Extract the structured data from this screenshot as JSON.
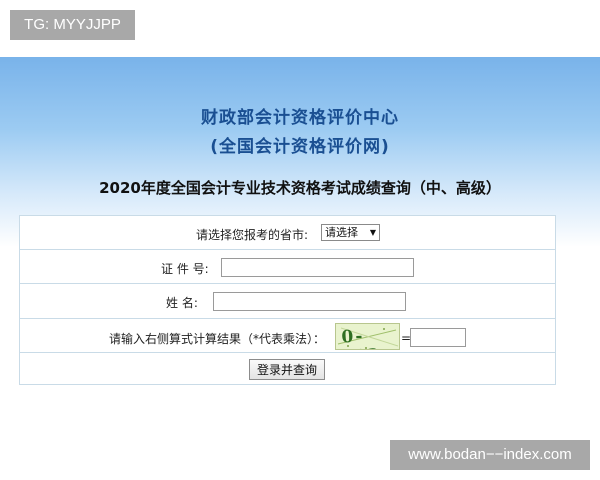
{
  "overlay": {
    "tg_label": "TG: MYYJJPP",
    "watermark": "www.bodan−−index.com"
  },
  "header": {
    "org_name": "财政部会计资格评价中心",
    "org_subname": "(全国会计资格评价网)",
    "title": "2020年度全国会计专业技术资格考试成绩查询（中、高级）"
  },
  "form": {
    "province_label": "请选择您报考的省市:",
    "province_select_value": "请选择",
    "id_label": "证 件 号:",
    "id_value": "",
    "name_label": "姓  名:",
    "name_value": "",
    "captcha_label": "请输入右侧算式计算结果（*代表乘法）：",
    "captcha_text": "0-4*3",
    "equals_sign": "=",
    "captcha_answer": "",
    "submit_label": "登录并查询"
  },
  "colors": {
    "header_gradient_top": "#79b3ea",
    "title_blue": "#1a4f92",
    "form_border": "#c9dbe7",
    "captcha_green": "#2f6f22"
  },
  "icons": {
    "select_arrow": "dropdown-arrow-icon"
  }
}
